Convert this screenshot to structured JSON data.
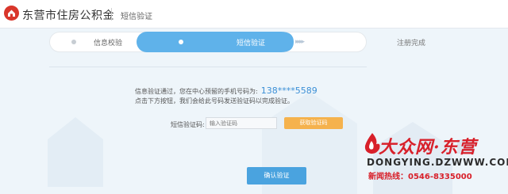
{
  "header": {
    "brand": "东营市住房公积金",
    "title": "短信验证"
  },
  "steps": [
    {
      "label": "信息校验",
      "state": "done"
    },
    {
      "label": "短信验证",
      "state": "active"
    },
    {
      "label": "注册完成",
      "state": "pending"
    }
  ],
  "info": {
    "line1": "信息验证通过，您在中心预留的手机号码为:",
    "phone": "138****5589",
    "line2": "点击下方按钮，我们会给此号码发送验证码以完成验证。"
  },
  "form": {
    "code_label": "短信验证码:",
    "code_placeholder": "输入验证码",
    "get_code_label": "获取验证码",
    "confirm_label": "确认验证"
  },
  "watermark": {
    "main": "大众网·东营",
    "url": "DONGYING.DZWWW.COM",
    "hotline": "新闻热线：0546-8335000"
  },
  "colors": {
    "accent": "#5fb2ea",
    "button": "#4aa3df",
    "get_code": "#f5b24d",
    "brand_red": "#d9362b"
  }
}
